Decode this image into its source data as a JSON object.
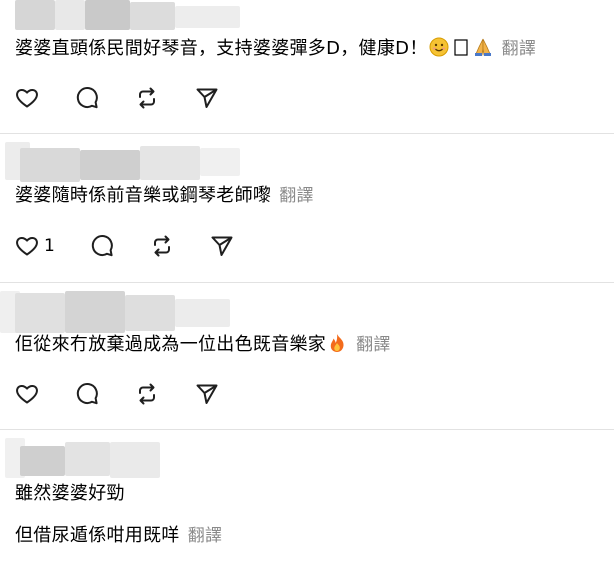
{
  "comments": [
    {
      "text": "婆婆直頭係民間好琴音，支持婆婆彈多D，健康D！",
      "emojis": [
        "smiling-face",
        "missing-glyph",
        "folded-hands"
      ],
      "translate_label": "翻譯",
      "like_count": ""
    },
    {
      "text": "婆婆隨時係前音樂或鋼琴老師嚟",
      "translate_label": "翻譯",
      "like_count": "1"
    },
    {
      "text": "佢從來冇放棄過成為一位出色既音樂家",
      "emojis": [
        "fire"
      ],
      "translate_label": "翻譯",
      "like_count": ""
    },
    {
      "text_line1": "雖然婆婆好勁",
      "text_line2": "但借尿遁係咁用既咩",
      "translate_label": "翻譯"
    }
  ],
  "icons": {
    "like": "heart-icon",
    "reply": "comment-bubble-icon",
    "repost": "repost-icon",
    "share": "send-icon"
  },
  "colors": {
    "text": "#000000",
    "translate": "#8a8a8a",
    "divider": "#e2e2e2",
    "icon": "#1f1f1f"
  }
}
